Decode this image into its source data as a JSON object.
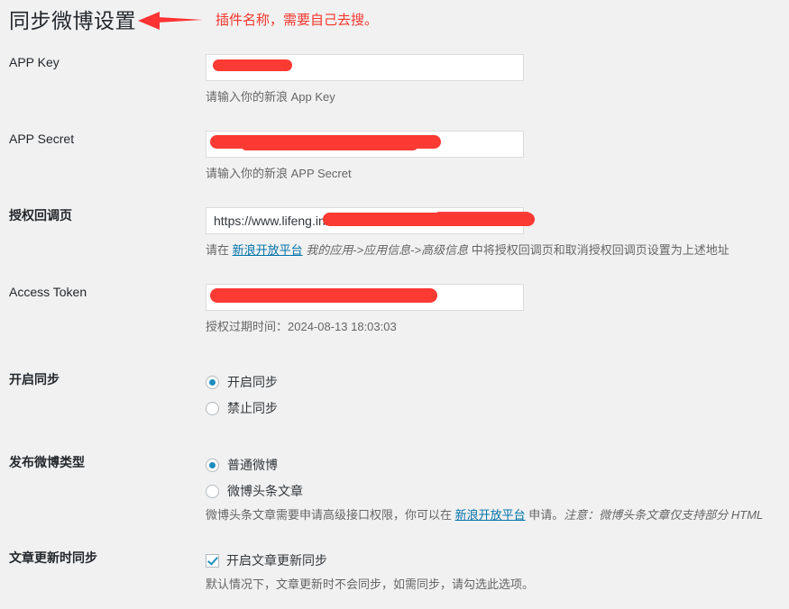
{
  "page": {
    "title": "同步微博设置",
    "annotation": "插件名称，需要自己去搜。"
  },
  "fields": {
    "app_key": {
      "label": "APP Key",
      "value": "",
      "help": "请输入你的新浪 App Key"
    },
    "app_secret": {
      "label": "APP Secret",
      "value": "",
      "help": "请输入你的新浪 APP Secret"
    },
    "callback": {
      "label": "授权回调页",
      "value": "https://www.lifeng.in/",
      "help_before": "请在 ",
      "help_link": "新浪开放平台",
      "help_path": "我的应用->应用信息->高级信息",
      "help_after": " 中将授权回调页和取消授权回调页设置为上述地址"
    },
    "access_token": {
      "label": "Access Token",
      "value": "",
      "help": "授权过期时间：2024-08-13 18:03:03"
    },
    "sync_enable": {
      "label": "开启同步",
      "options": [
        {
          "label": "开启同步",
          "checked": true
        },
        {
          "label": "禁止同步",
          "checked": false
        }
      ]
    },
    "weibo_type": {
      "label": "发布微博类型",
      "options": [
        {
          "label": "普通微博",
          "checked": true
        },
        {
          "label": "微博头条文章",
          "checked": false
        }
      ],
      "help_before": "微博头条文章需要申请高级接口权限，你可以在 ",
      "help_link": "新浪开放平台",
      "help_mid": " 申请。",
      "help_note": "注意：微博头条文章仅支持部分 HTML"
    },
    "update_sync": {
      "label": "文章更新时同步",
      "checkbox_label": "开启文章更新同步",
      "checked": true,
      "help": "默认情况下，文章更新时不会同步，如需同步，请勾选此选项。"
    }
  },
  "colors": {
    "background": "#f1f1f1",
    "accent": "#1e8cbe",
    "link": "#0073aa",
    "annotation": "#f4362c",
    "redaction": "#fb3a33",
    "text": "#23282d",
    "help_text": "#666666"
  }
}
